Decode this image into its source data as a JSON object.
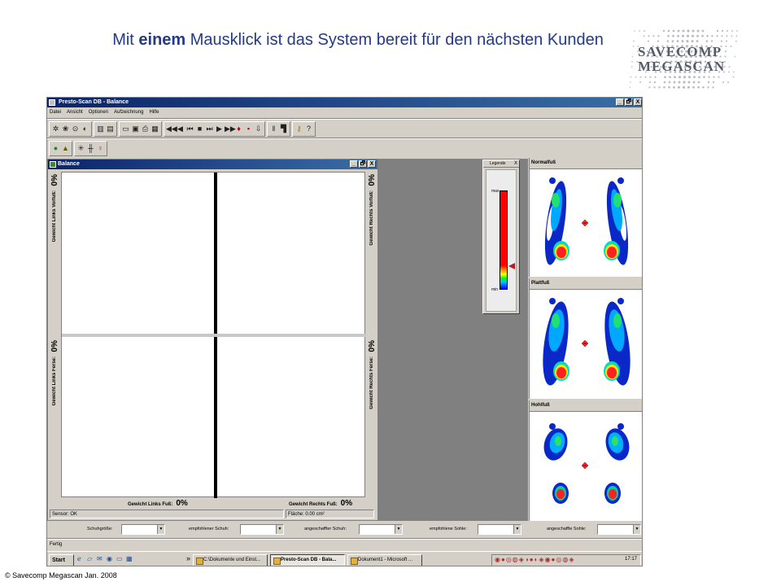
{
  "slide": {
    "title_pre": "Mit ",
    "title_bold": "einem",
    "title_post": " Mausklick ist das System bereit für den nächsten Kunden",
    "logo_line1": "SAVECOMP",
    "logo_line2": "MEGASCAN",
    "copyright": "© Savecomp Megascan Jan. 2008"
  },
  "app": {
    "title": "Presto-Scan DB - Balance",
    "menu": [
      "Datei",
      "Ansicht",
      "Optionen",
      "Aufzeichnung",
      "Hilfe"
    ],
    "window_buttons": [
      "_",
      "🗗",
      "X"
    ]
  },
  "balance": {
    "title": "Balance",
    "label_left_fore": "Gewicht Links Vorfuß:",
    "pct_left_fore": "0%",
    "label_left_heel": "Gewicht Links Ferse:",
    "pct_left_heel": "0%",
    "label_right_fore": "Gewicht Rechts Vorfuß:",
    "pct_right_fore": "0%",
    "label_right_heel": "Gewicht Rechts Ferse:",
    "pct_right_heel": "0%",
    "label_left_foot": "Gewicht Links Fuß:",
    "pct_left_foot": "0%",
    "label_right_foot": "Gewicht Rechts Fuß:",
    "pct_right_foot": "0%",
    "status_sensor": "Sensor: OK",
    "status_area": "Fläche: 0.00 cm²"
  },
  "legend": {
    "title": "Legende",
    "close": "X",
    "max": "max",
    "min": "min",
    "marker_level": 0.24
  },
  "panels": [
    {
      "title": "Normalfuß"
    },
    {
      "title": "Plattfuß"
    },
    {
      "title": "Hohlfuß"
    }
  ],
  "dropdowns": {
    "shoe_size": "Schuhgröße:",
    "recommended_shoe": "empfohlener Schuh:",
    "purchased_shoe": "angeschaffter Schuh:",
    "recommended_sole": "empfohlene Sohle:",
    "purchased_sole": "angeschaffte Sohle:",
    "arrow": "▼"
  },
  "status_bar": "Fertig",
  "taskbar": {
    "start": "Start",
    "tasks": [
      "C:\\Dokumente und Einst...",
      "Presto-Scan DB - Bala...",
      "Dokument1 - Microsoft ..."
    ],
    "chevron": "»",
    "clock": "17:17"
  }
}
